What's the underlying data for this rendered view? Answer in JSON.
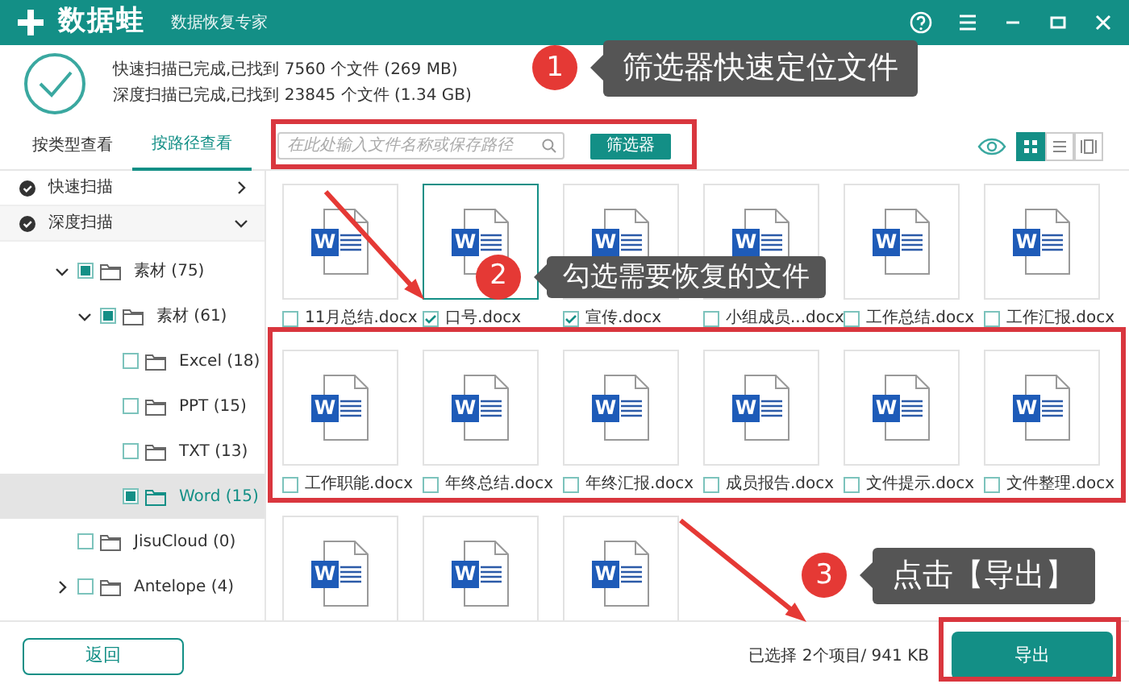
{
  "window": {
    "logo": "数据蛙",
    "subtitle": "数据恢复专家"
  },
  "scan_summary": [
    "快速扫描已完成,已找到 7560 个文件 (269 MB)",
    "深度扫描已完成,已找到 23845 个文件 (1.34 GB)"
  ],
  "tabs": [
    {
      "label": "按类型查看",
      "selected": false
    },
    {
      "label": "按路径查看",
      "selected": true
    }
  ],
  "search": {
    "placeholder": "在此处输入文件名称或保存路径"
  },
  "filter_button": "筛选器",
  "view_modes": [
    {
      "kind": "grid",
      "selected": true
    },
    {
      "kind": "list",
      "selected": false
    },
    {
      "kind": "detail",
      "selected": false
    }
  ],
  "sidebar": {
    "scans": [
      {
        "label": "快速扫描",
        "expanded": false
      },
      {
        "label": "深度扫描",
        "expanded": true
      }
    ],
    "tree": [
      {
        "label": "素材 (75)",
        "partial": true,
        "expanded": true,
        "selected": false,
        "children": [
          {
            "label": "素材 (61)",
            "partial": true,
            "expanded": true,
            "selected": false,
            "children": [
              {
                "label": "Excel (18)",
                "partial": false,
                "selected": false
              },
              {
                "label": "PPT (15)",
                "partial": false,
                "selected": false
              },
              {
                "label": "TXT (13)",
                "partial": false,
                "selected": false
              },
              {
                "label": "Word (15)",
                "partial": true,
                "selected": true
              }
            ]
          }
        ]
      },
      {
        "label": "JisuCloud (0)",
        "partial": false,
        "selected": false
      },
      {
        "label": "Antelope (4)",
        "partial": false,
        "expanded": false,
        "selected": false
      }
    ]
  },
  "files": [
    {
      "icon_text": "W",
      "name": "11月总结.docx",
      "checked": false,
      "selected": false
    },
    {
      "icon_text": "W",
      "name": "口号.docx",
      "checked": true,
      "selected": true
    },
    {
      "icon_text": "W",
      "name": "宣传.docx",
      "checked": true,
      "selected": false
    },
    {
      "icon_text": "W",
      "name": "小组成员...docx",
      "checked": false,
      "selected": false
    },
    {
      "icon_text": "W",
      "name": "工作总结.docx",
      "checked": false,
      "selected": false
    },
    {
      "icon_text": "W",
      "name": "工作汇报.docx",
      "checked": false,
      "selected": false
    },
    {
      "icon_text": "W",
      "name": "工作职能.docx",
      "checked": false,
      "selected": false
    },
    {
      "icon_text": "W",
      "name": "年终总结.docx",
      "checked": false,
      "selected": false
    },
    {
      "icon_text": "W",
      "name": "年终汇报.docx",
      "checked": false,
      "selected": false
    },
    {
      "icon_text": "W",
      "name": "成员报告.docx",
      "checked": false,
      "selected": false
    },
    {
      "icon_text": "W",
      "name": "文件提示.docx",
      "checked": false,
      "selected": false
    },
    {
      "icon_text": "W",
      "name": "文件整理.docx",
      "checked": false,
      "selected": false
    },
    {
      "icon_text": "W",
      "selected": false
    },
    {
      "icon_text": "W",
      "selected": false
    },
    {
      "icon_text": "W",
      "selected": false
    }
  ],
  "footer": {
    "back_button": "返回",
    "selection_status": "已选择 2个项目/ 941 KB",
    "export_button": "导出"
  },
  "annotations": [
    {
      "number": "1",
      "text": "筛选器快速定位文件"
    },
    {
      "number": "2",
      "text": "勾选需要恢复的文件"
    },
    {
      "number": "3",
      "text": "点击【导出】"
    }
  ]
}
